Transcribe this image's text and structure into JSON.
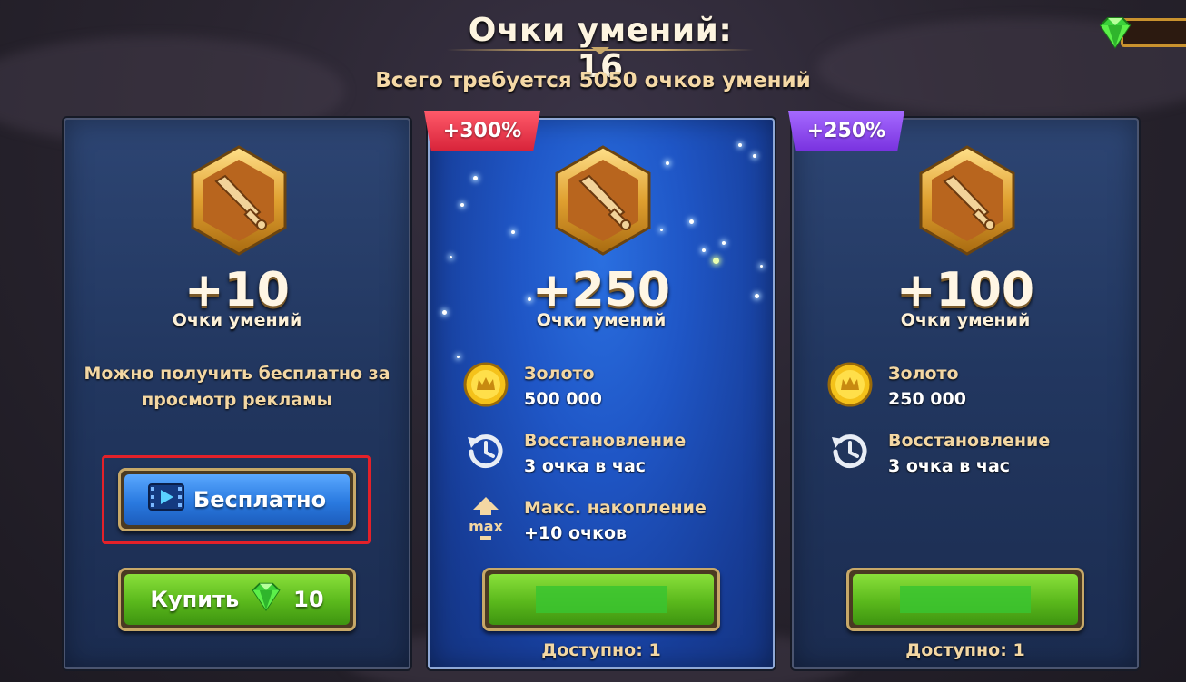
{
  "header": {
    "title": "Очки умений: 16",
    "subtitle": "Всего требуется 5050 очков умений"
  },
  "currency": {
    "icon": "gem-icon",
    "value": ""
  },
  "cards": [
    {
      "amount": "+10",
      "amount_label": "Очки умений",
      "description_line1": "Можно получить бесплатно за",
      "description_line2": "просмотр рекламы",
      "free_button_label": "Бесплатно",
      "free_button_icon": "video-play-icon",
      "buy_button_label": "Купить",
      "buy_price": "10",
      "buy_icon": "gem-icon"
    },
    {
      "tag": "+300%",
      "tag_color": "#e8304a",
      "amount": "+250",
      "amount_label": "Очки умений",
      "rows": [
        {
          "icon": "gold-coin-icon",
          "title": "Золото",
          "value": "500 000"
        },
        {
          "icon": "restore-clock-icon",
          "title": "Восстановление",
          "value": "3 очка в час"
        },
        {
          "icon": "max-arrow-icon",
          "title": "Макс. накопление",
          "value": "+10 очков"
        }
      ],
      "available": "Доступно: 1"
    },
    {
      "tag": "+250%",
      "tag_color": "#8a46f0",
      "amount": "+100",
      "amount_label": "Очки умений",
      "rows": [
        {
          "icon": "gold-coin-icon",
          "title": "Золото",
          "value": "250 000"
        },
        {
          "icon": "restore-clock-icon",
          "title": "Восстановление",
          "value": "3 очка в час"
        }
      ],
      "available": "Доступно: 1"
    }
  ],
  "colors": {
    "card_bg": "#223760",
    "highlight_card_bg": "#1f56c6",
    "green_button": "#5ab81c",
    "blue_button": "#2a7ae0",
    "gold_text": "#f3d7a3",
    "selection_frame": "#e32129"
  }
}
